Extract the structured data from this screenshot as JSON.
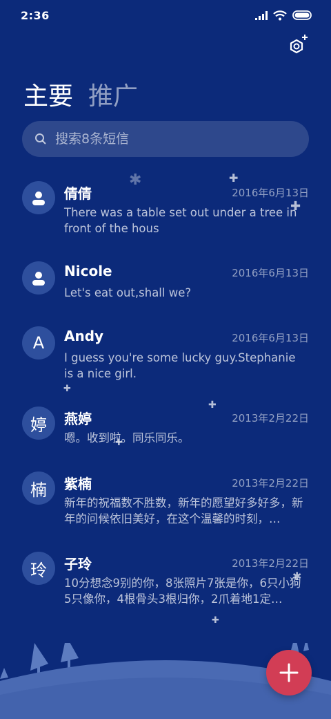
{
  "status": {
    "time": "2:36"
  },
  "tabs": {
    "primary": "主要",
    "promotions": "推广"
  },
  "search": {
    "placeholder": "搜索8条短信"
  },
  "messages": [
    {
      "name": "倩倩",
      "date": "2016年6月13日",
      "preview": "There was a table set out under a tree in front of the hous",
      "avatar": ""
    },
    {
      "name": "Nicole",
      "date": "2016年6月13日",
      "preview": "Let's eat out,shall we?",
      "avatar": ""
    },
    {
      "name": "Andy",
      "date": "2016年6月13日",
      "preview": "I guess you're some lucky guy.Stephanie is a nice girl.",
      "avatar": "A"
    },
    {
      "name": "燕婷",
      "date": "2013年2月22日",
      "preview": "嗯。收到啦。同乐同乐。",
      "avatar": "婷"
    },
    {
      "name": "紫楠",
      "date": "2013年2月22日",
      "preview": "新年的祝福数不胜数，新年的愿望好多好多，新年的问候依旧美好，在这个温馨的时刻，…",
      "avatar": "楠"
    },
    {
      "name": "子玲",
      "date": "2013年2月22日",
      "preview": "10分想念9别的你，8张照片7张是你，6只小狗5只像你，4根骨头3根归你，2爪着地1定…",
      "avatar": "玲"
    }
  ],
  "colors": {
    "background": "#0c2a7a",
    "avatar": "#2e4f9d",
    "fab": "#d23d55"
  },
  "icons": {
    "settings": "settings-icon",
    "search": "search-icon",
    "compose": "plus-icon",
    "contact": "person-icon"
  }
}
